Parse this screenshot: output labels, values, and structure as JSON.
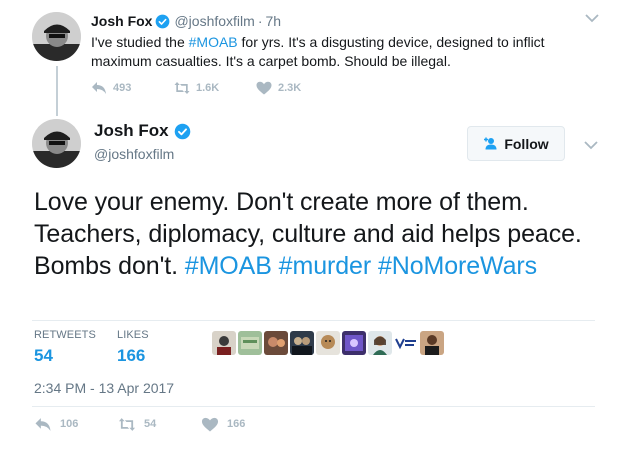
{
  "parent_tweet": {
    "name": "Josh Fox",
    "handle": "@joshfoxfilm",
    "separator": "·",
    "time": "7h",
    "text_before": "I've studied the ",
    "hashtag": "#MOAB",
    "text_after": " for yrs. It's a disgusting device, designed to inflict maximum casualties. It's a carpet bomb. Should be illegal.",
    "replies": "493",
    "retweets": "1.6K",
    "likes": "2.3K"
  },
  "main_tweet": {
    "name": "Josh Fox",
    "handle": "@joshfoxfilm",
    "follow_label": "Follow",
    "text_plain": "Love your enemy. Don't create more of them. Teachers, diplomacy, culture and aid helps peace. Bombs don't. ",
    "hashtags": [
      "#MOAB",
      "#murder",
      "#NoMoreWars"
    ],
    "retweets_label": "RETWEETS",
    "retweets_count": "54",
    "likes_label": "LIKES",
    "likes_count": "166",
    "timestamp": "2:34 PM - 13 Apr 2017",
    "action_replies": "106",
    "action_retweets": "54",
    "action_likes": "166"
  },
  "colors": {
    "link": "#1b95e0",
    "muted": "#657786",
    "action": "#aab8c2",
    "verified": "#1da1f2"
  },
  "icons": [
    "reply-icon",
    "retweet-icon",
    "heart-icon",
    "verified-badge-icon",
    "chevron-down-icon",
    "follow-person-plus-icon"
  ]
}
